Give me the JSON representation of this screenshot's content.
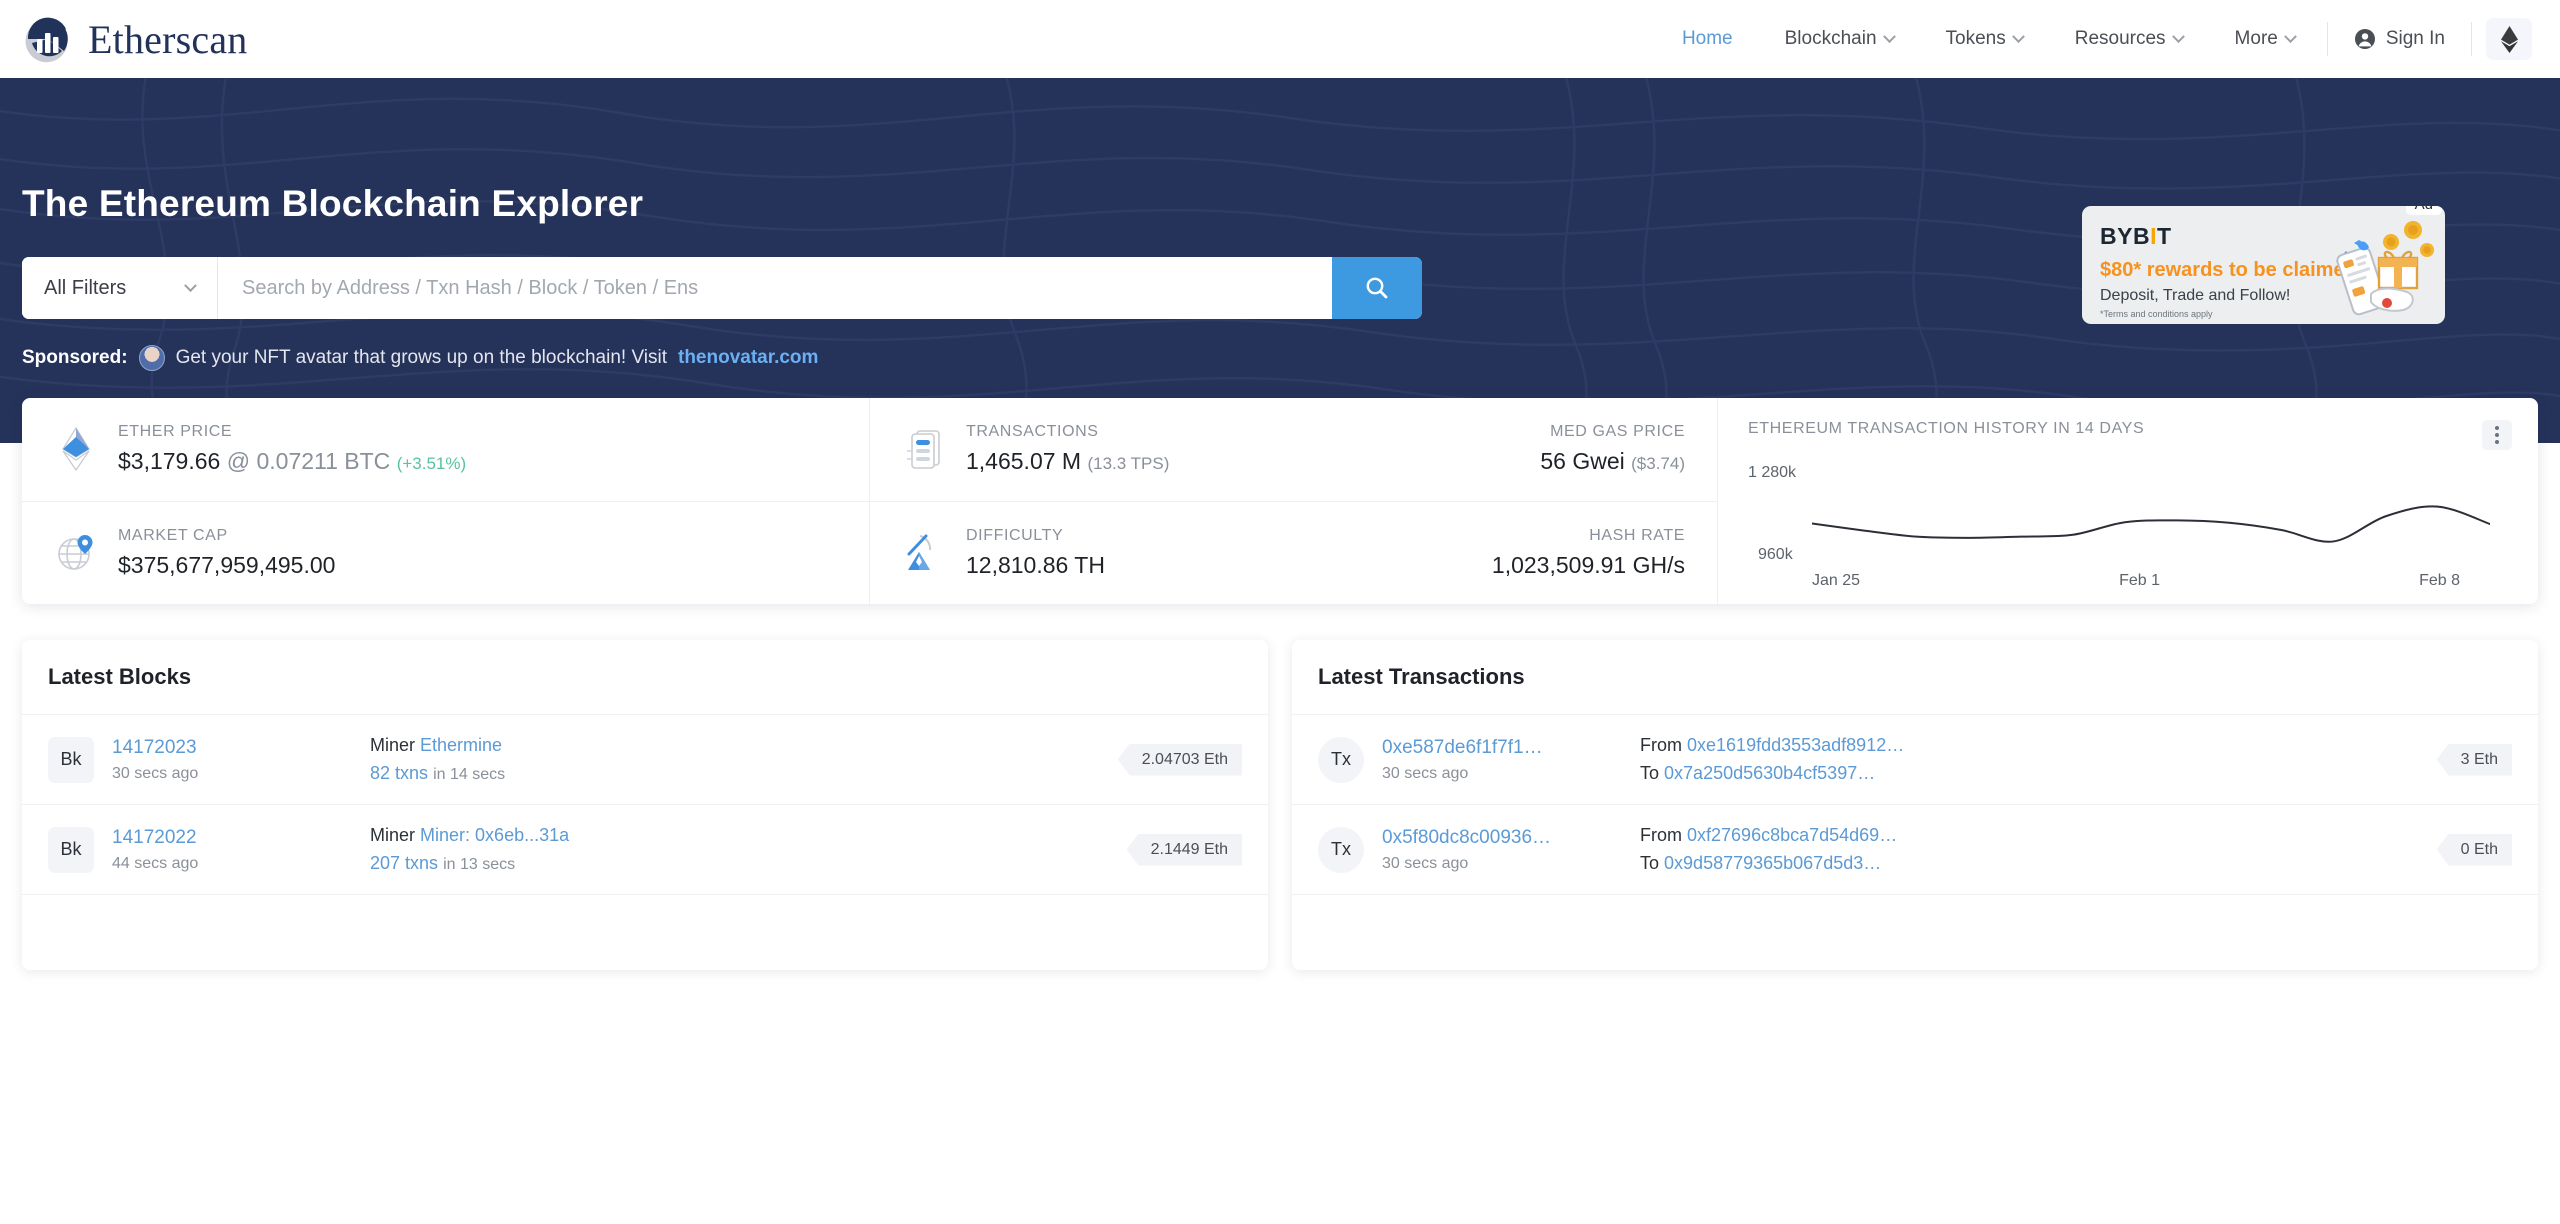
{
  "brand": {
    "name": "Etherscan"
  },
  "nav": {
    "items": [
      {
        "label": "Home",
        "active": true,
        "caret": false
      },
      {
        "label": "Blockchain",
        "active": false,
        "caret": true
      },
      {
        "label": "Tokens",
        "active": false,
        "caret": true
      },
      {
        "label": "Resources",
        "active": false,
        "caret": true
      },
      {
        "label": "More",
        "active": false,
        "caret": true
      }
    ],
    "sign_in": "Sign In",
    "network_icon": "ethereum-diamond-icon"
  },
  "hero": {
    "title": "The Ethereum Blockchain Explorer",
    "search": {
      "filter_label": "All Filters",
      "placeholder": "Search by Address / Txn Hash / Block / Token / Ens",
      "value": "",
      "button_icon": "search-icon"
    },
    "sponsored": {
      "prefix": "Sponsored:",
      "text": "Get your NFT avatar that grows up on the blockchain! Visit",
      "link": "thenovatar.com"
    }
  },
  "ad": {
    "badge": "Ad",
    "brand_a": "BYB",
    "brand_i": "I",
    "brand_b": "T",
    "headline_amount": "$80*",
    "headline_rest": "rewards to be claimed",
    "sub": "Deposit, Trade and Follow!",
    "terms": "*Terms and conditions apply"
  },
  "stats": {
    "ether_price": {
      "label": "ETHER PRICE",
      "value": "$3,179.66",
      "at": "@",
      "btc": "0.07211 BTC",
      "change": "(+3.51%)",
      "icon": "ethereum-diamond-icon"
    },
    "market_cap": {
      "label": "MARKET CAP",
      "value": "$375,677,959,495.00",
      "icon": "globe-pin-icon"
    },
    "transactions": {
      "label": "TRANSACTIONS",
      "value": "1,465.07 M",
      "sub": "(13.3 TPS)",
      "icon": "list-icon"
    },
    "med_gas_price": {
      "label": "MED GAS PRICE",
      "value": "56 Gwei",
      "sub": "($3.74)"
    },
    "difficulty": {
      "label": "DIFFICULTY",
      "value": "12,810.86 TH",
      "icon": "pickaxe-mountain-icon"
    },
    "hash_rate": {
      "label": "HASH RATE",
      "value": "1,023,509.91 GH/s"
    }
  },
  "chart_data": {
    "type": "line",
    "title": "ETHEREUM TRANSACTION HISTORY IN 14 DAYS",
    "xlabel": "",
    "ylabel": "",
    "ylim": [
      960000,
      1280000
    ],
    "y_tick_labels": [
      "1 280k",
      "960k"
    ],
    "x_tick_labels": [
      "Jan 25",
      "Feb 1",
      "Feb 8"
    ],
    "grid": false,
    "legend": "none",
    "line_color": "#2b2f36",
    "x": [
      "Jan 25",
      "Jan 26",
      "Jan 27",
      "Jan 28",
      "Jan 29",
      "Jan 30",
      "Jan 31",
      "Feb 1",
      "Feb 2",
      "Feb 3",
      "Feb 4",
      "Feb 5",
      "Feb 6",
      "Feb 8"
    ],
    "values": [
      1142000,
      1118000,
      1098000,
      1094000,
      1098000,
      1104000,
      1146000,
      1152000,
      1144000,
      1120000,
      1082000,
      1166000,
      1198000,
      1140000
    ]
  },
  "latest_blocks": {
    "title": "Latest Blocks",
    "rows": [
      {
        "tag": "Bk",
        "number": "14172023",
        "age": "30 secs ago",
        "miner_label": "Miner",
        "miner": "Ethermine",
        "txns": "82 txns",
        "in_time": "in 14 secs",
        "reward": "2.04703 Eth"
      },
      {
        "tag": "Bk",
        "number": "14172022",
        "age": "44 secs ago",
        "miner_label": "Miner",
        "miner": "Miner: 0x6eb...31a",
        "txns": "207 txns",
        "in_time": "in 13 secs",
        "reward": "2.1449 Eth"
      }
    ]
  },
  "latest_transactions": {
    "title": "Latest Transactions",
    "rows": [
      {
        "tag": "Tx",
        "hash": "0xe587de6f1f7f1…",
        "age": "30 secs ago",
        "from_label": "From",
        "from": "0xe1619fdd3553adf8912…",
        "to_label": "To",
        "to": "0x7a250d5630b4cf5397…",
        "amount": "3 Eth"
      },
      {
        "tag": "Tx",
        "hash": "0x5f80dc8c00936…",
        "age": "30 secs ago",
        "from_label": "From",
        "from": "0xf27696c8bca7d54d69…",
        "to_label": "To",
        "to": "0x9d58779365b067d5d3…",
        "amount": "0 Eth"
      }
    ]
  },
  "colors": {
    "hero_bg": "#25325a",
    "accent_blue": "#3d9ae0",
    "link_blue": "#5b9ad5",
    "brand_navy": "#21325b",
    "green": "#57c3a4",
    "ad_orange": "#f7921e"
  }
}
